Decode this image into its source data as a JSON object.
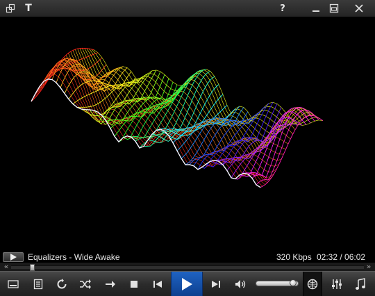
{
  "titlebar": {
    "text_button_label": "T",
    "help_label": "?",
    "icons": [
      "skin-icon",
      "help-icon",
      "minimize-icon",
      "restore-icon",
      "close-icon"
    ]
  },
  "now_playing": {
    "title": "Equalizers - Wide Awake",
    "bitrate": "320 Kbps",
    "time": "02:32 / 06:02"
  },
  "seek": {
    "position_fraction": 0.05
  },
  "volume": {
    "level_fraction": 0.95
  },
  "controls": [
    "fullscreen-icon",
    "playlist-icon",
    "repeat-icon",
    "shuffle-icon",
    "next-arrow-icon",
    "stop-icon",
    "previous-icon",
    "play-icon",
    "next-icon",
    "volume-icon",
    "visualization-icon",
    "equalizer-icon",
    "music-note-icon"
  ],
  "colors": {
    "play_button": "#1a56b0",
    "background": "#000000",
    "control_bar": "#2b2b2b"
  }
}
